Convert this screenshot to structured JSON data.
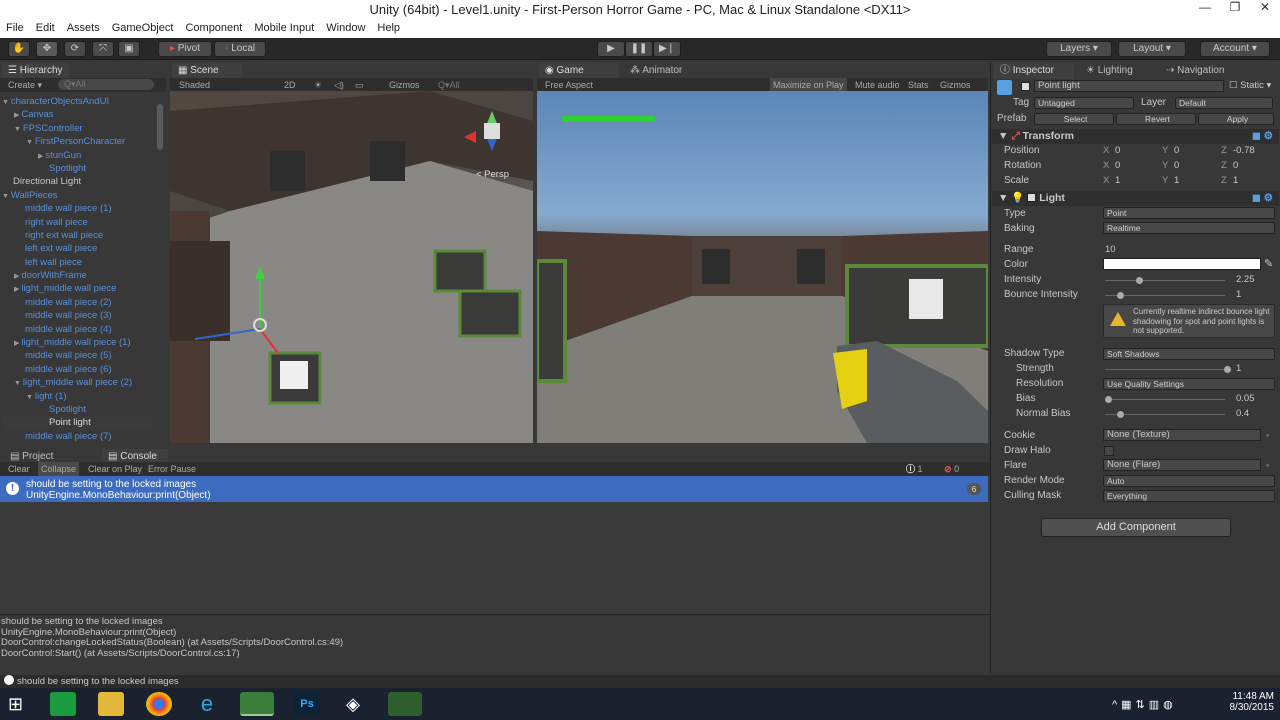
{
  "window": {
    "title": "Unity (64bit) - Level1.unity - First-Person Horror Game - PC, Mac & Linux Standalone <DX11>"
  },
  "menu": [
    "File",
    "Edit",
    "Assets",
    "GameObject",
    "Component",
    "Mobile Input",
    "Window",
    "Help"
  ],
  "toolbar": {
    "pivot": "Pivot",
    "local": "Local",
    "layers": "Layers",
    "layout": "Layout",
    "account": "Account"
  },
  "hierarchy": {
    "tab": "Hierarchy",
    "create": "Create",
    "search_placeholder": "Q▾All",
    "items": [
      {
        "label": "characterObjectsAndUI",
        "indent": 0,
        "style": "blue",
        "arrow": "▼"
      },
      {
        "label": "Canvas",
        "indent": 1,
        "style": "blue",
        "arrow": "▶"
      },
      {
        "label": "FPSController",
        "indent": 1,
        "style": "blue",
        "arrow": "▼"
      },
      {
        "label": "FirstPersonCharacter",
        "indent": 2,
        "style": "blue",
        "arrow": "▼"
      },
      {
        "label": "stunGun",
        "indent": 3,
        "style": "blue",
        "arrow": "▶"
      },
      {
        "label": "Spotlight",
        "indent": 3,
        "style": "blue",
        "arrow": ""
      },
      {
        "label": "Directional Light",
        "indent": 0,
        "style": "plain",
        "arrow": ""
      },
      {
        "label": "WallPieces",
        "indent": 0,
        "style": "blue",
        "arrow": "▼"
      },
      {
        "label": "middle wall piece (1)",
        "indent": 1,
        "style": "blue",
        "arrow": ""
      },
      {
        "label": "right wall piece",
        "indent": 1,
        "style": "blue",
        "arrow": ""
      },
      {
        "label": "right ext wall piece",
        "indent": 1,
        "style": "blue",
        "arrow": ""
      },
      {
        "label": "left ext wall piece",
        "indent": 1,
        "style": "blue",
        "arrow": ""
      },
      {
        "label": "left wall piece",
        "indent": 1,
        "style": "blue",
        "arrow": ""
      },
      {
        "label": "doorWithFrame",
        "indent": 1,
        "style": "blue",
        "arrow": "▶"
      },
      {
        "label": "light_middle wall piece",
        "indent": 1,
        "style": "blue",
        "arrow": "▶"
      },
      {
        "label": "middle wall piece (2)",
        "indent": 1,
        "style": "blue",
        "arrow": ""
      },
      {
        "label": "middle wall piece (3)",
        "indent": 1,
        "style": "blue",
        "arrow": ""
      },
      {
        "label": "middle wall piece (4)",
        "indent": 1,
        "style": "blue",
        "arrow": ""
      },
      {
        "label": "light_middle wall piece (1)",
        "indent": 1,
        "style": "blue",
        "arrow": "▶"
      },
      {
        "label": "middle wall piece (5)",
        "indent": 1,
        "style": "blue",
        "arrow": ""
      },
      {
        "label": "middle wall piece (6)",
        "indent": 1,
        "style": "blue",
        "arrow": ""
      },
      {
        "label": "light_middle wall piece (2)",
        "indent": 1,
        "style": "blue",
        "arrow": "▼"
      },
      {
        "label": "light (1)",
        "indent": 2,
        "style": "blue",
        "arrow": "▼"
      },
      {
        "label": "Spotlight",
        "indent": 3,
        "style": "blue",
        "arrow": ""
      },
      {
        "label": "Point light",
        "indent": 3,
        "style": "sel",
        "arrow": ""
      },
      {
        "label": "middle wall piece (7)",
        "indent": 1,
        "style": "blue",
        "arrow": ""
      }
    ]
  },
  "scene": {
    "tab": "Scene",
    "shading": "Shaded",
    "mode2d": "2D",
    "gizmos": "Gizmos",
    "search": "Q▾All",
    "persp": "< Persp"
  },
  "game": {
    "tab": "Game",
    "animator_tab": "Animator",
    "aspect": "Free Aspect",
    "maximize": "Maximize on Play",
    "mute": "Mute audio",
    "stats": "Stats",
    "gizmos": "Gizmos"
  },
  "console": {
    "project_tab": "Project",
    "tab": "Console",
    "buttons": [
      "Clear",
      "Collapse",
      "Clear on Play",
      "Error Pause"
    ],
    "warn_count": "1",
    "err_count": "0",
    "entry_line1": "should be setting to the locked images",
    "entry_line2": "UnityEngine.MonoBehaviour:print(Object)",
    "entry_count": "6",
    "detail": [
      "should be setting to the locked images",
      "UnityEngine.MonoBehaviour:print(Object)",
      "DoorControl:changeLockedStatus(Boolean) (at Assets/Scripts/DoorControl.cs:49)",
      "DoorControl:Start() (at Assets/Scripts/DoorControl.cs:17)"
    ]
  },
  "status": {
    "message": "should be setting to the locked images"
  },
  "inspector": {
    "tabs": [
      "Inspector",
      "Lighting",
      "Navigation"
    ],
    "object_name": "Point light",
    "static": "Static",
    "tag_label": "Tag",
    "tag": "Untagged",
    "layer_label": "Layer",
    "layer": "Default",
    "prefab_label": "Prefab",
    "prefab_select": "Select",
    "prefab_revert": "Revert",
    "prefab_apply": "Apply",
    "transform": {
      "title": "Transform",
      "rows": [
        {
          "label": "Position",
          "x": "0",
          "y": "0",
          "z": "-0.78"
        },
        {
          "label": "Rotation",
          "x": "0",
          "y": "0",
          "z": "0"
        },
        {
          "label": "Scale",
          "x": "1",
          "y": "1",
          "z": "1"
        }
      ]
    },
    "light": {
      "title": "Light",
      "type_label": "Type",
      "type": "Point",
      "baking_label": "Baking",
      "baking": "Realtime",
      "range_label": "Range",
      "range": "10",
      "color_label": "Color",
      "color": "#ffffff",
      "intensity_label": "Intensity",
      "intensity": "2.25",
      "bounce_label": "Bounce Intensity",
      "bounce": "1",
      "warning": "Currently realtime indirect bounce light shadowing for spot and point lights is not supported.",
      "shadow_type_label": "Shadow Type",
      "shadow_type": "Soft Shadows",
      "strength_label": "Strength",
      "strength": "1",
      "resolution_label": "Resolution",
      "resolution": "Use Quality Settings",
      "bias_label": "Bias",
      "bias": "0.05",
      "nbias_label": "Normal Bias",
      "nbias": "0.4",
      "cookie_label": "Cookie",
      "cookie": "None (Texture)",
      "halo_label": "Draw Halo",
      "flare_label": "Flare",
      "flare": "None (Flare)",
      "render_label": "Render Mode",
      "render": "Auto",
      "mask_label": "Culling Mask",
      "mask": "Everything"
    },
    "add_component": "Add Component"
  },
  "clock": {
    "time": "11:48 AM",
    "date": "8/30/2015"
  },
  "colors": {
    "accent": "#3d6bbf",
    "hierarchy_blue": "#5b8fd8"
  }
}
